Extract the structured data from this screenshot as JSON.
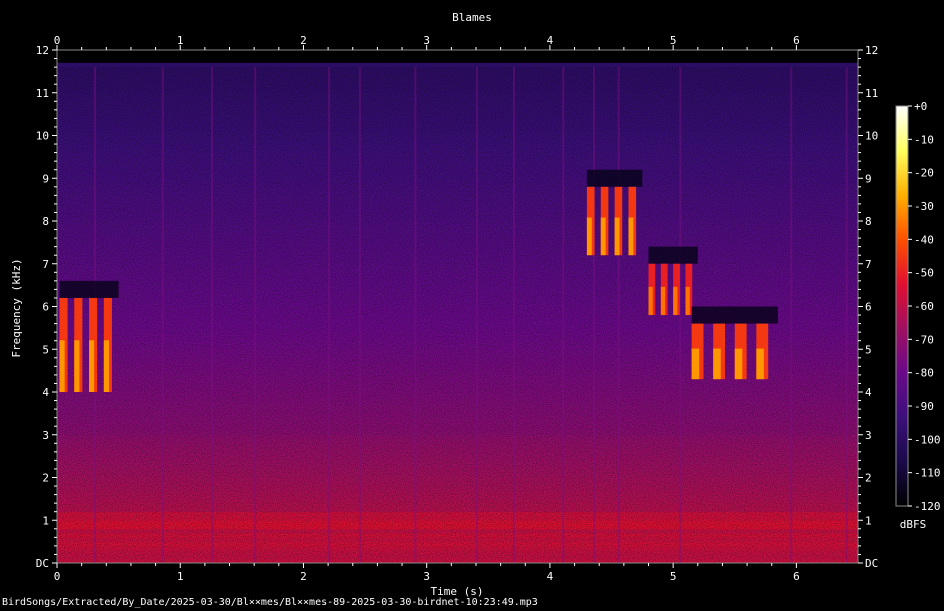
{
  "chart_data": {
    "type": "heatmap",
    "title": "Blames",
    "xlabel": "Time (s)",
    "ylabel": "Frequency (kHz)",
    "xlim": [
      0,
      6.5
    ],
    "ylim": [
      0,
      12
    ],
    "x_ticks": [
      "0",
      "1",
      "2",
      "3",
      "4",
      "5",
      "6"
    ],
    "y_ticks": [
      "DC",
      "1",
      "2",
      "3",
      "4",
      "5",
      "6",
      "7",
      "8",
      "9",
      "10",
      "11",
      "12"
    ],
    "colorbar": {
      "label": "dBFS",
      "ticks": [
        "+0",
        "-10",
        "-20",
        "-30",
        "-40",
        "-50",
        "-60",
        "-70",
        "-80",
        "-90",
        "-100",
        "-110",
        "-120"
      ],
      "range": [
        -120,
        0
      ],
      "colormap": [
        "#000000",
        "#1a0a4a",
        "#3c0f7a",
        "#6a0a8a",
        "#a01060",
        "#e01030",
        "#ff5000",
        "#ffb000",
        "#ffff60",
        "#ffffff"
      ]
    },
    "grid": true,
    "calls": [
      {
        "t_start": 0.02,
        "t_end": 0.5,
        "f_low": 4.0,
        "f_high": 6.2,
        "peak_dbfs": -30
      },
      {
        "t_start": 4.3,
        "t_end": 4.75,
        "f_low": 7.2,
        "f_high": 8.8,
        "peak_dbfs": -30
      },
      {
        "t_start": 4.8,
        "t_end": 5.2,
        "f_low": 5.8,
        "f_high": 7.0,
        "peak_dbfs": -35
      },
      {
        "t_start": 5.15,
        "t_end": 5.85,
        "f_low": 4.3,
        "f_high": 5.6,
        "peak_dbfs": -30
      }
    ],
    "noise_band": {
      "f_low": 0,
      "f_high": 1.2,
      "level_dbfs": -55
    }
  },
  "footer": {
    "path": "BirdSongs/Extracted/By_Date/2025-03-30/Bl××mes/Bl××mes-89-2025-03-30-birdnet-10:23:49.mp3"
  }
}
